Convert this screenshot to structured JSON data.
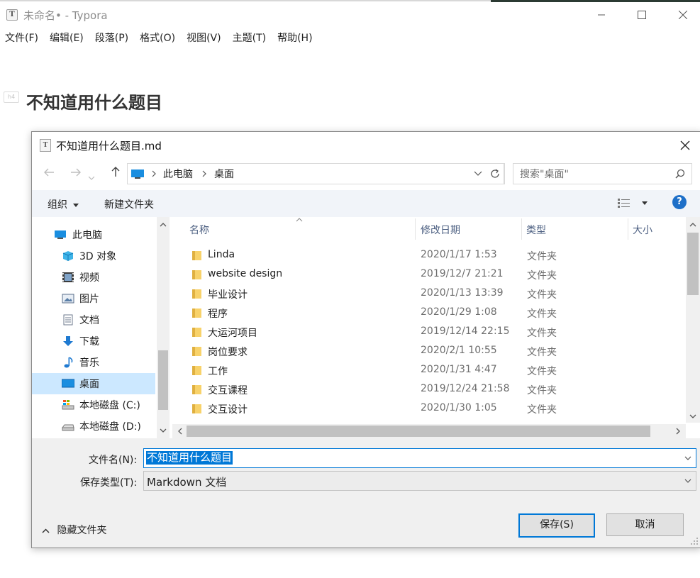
{
  "window": {
    "app_icon_letter": "T",
    "title": "未命名• - Typora"
  },
  "menu": [
    "文件(F)",
    "编辑(E)",
    "段落(P)",
    "格式(O)",
    "视图(V)",
    "主题(T)",
    "帮助(H)"
  ],
  "document": {
    "heading_badge": "h4",
    "heading": "不知道用什么题目"
  },
  "dialog": {
    "title": "不知道用什么题目.md",
    "breadcrumb": [
      "此电脑",
      "桌面"
    ],
    "search_placeholder": "搜索\"桌面\"",
    "toolbar": {
      "organize": "组织",
      "new_folder": "新建文件夹"
    },
    "help": "?",
    "sidebar": [
      {
        "label": "此电脑",
        "icon": "computer-icon"
      },
      {
        "label": "3D 对象",
        "icon": "3d-objects-icon"
      },
      {
        "label": "视频",
        "icon": "video-icon"
      },
      {
        "label": "图片",
        "icon": "pictures-icon"
      },
      {
        "label": "文档",
        "icon": "documents-icon"
      },
      {
        "label": "下载",
        "icon": "downloads-icon"
      },
      {
        "label": "音乐",
        "icon": "music-icon"
      },
      {
        "label": "桌面",
        "icon": "desktop-icon",
        "selected": true
      },
      {
        "label": "本地磁盘 (C:)",
        "icon": "drive-c-icon"
      },
      {
        "label": "本地磁盘 (D:)",
        "icon": "drive-icon"
      }
    ],
    "columns": {
      "name": "名称",
      "date": "修改日期",
      "type": "类型",
      "size": "大小"
    },
    "files": [
      {
        "name": "Linda",
        "date": "2020/1/17 1:53",
        "type": "文件夹"
      },
      {
        "name": "website design",
        "date": "2019/12/7 21:21",
        "type": "文件夹"
      },
      {
        "name": "毕业设计",
        "date": "2020/1/13 13:39",
        "type": "文件夹"
      },
      {
        "name": "程序",
        "date": "2020/1/29 1:08",
        "type": "文件夹"
      },
      {
        "name": "大运河项目",
        "date": "2019/12/14 22:15",
        "type": "文件夹"
      },
      {
        "name": "岗位要求",
        "date": "2020/2/1 10:55",
        "type": "文件夹"
      },
      {
        "name": "工作",
        "date": "2020/1/31 4:47",
        "type": "文件夹"
      },
      {
        "name": "交互课程",
        "date": "2019/12/24 21:58",
        "type": "文件夹"
      },
      {
        "name": "交互设计",
        "date": "2020/1/30 1:05",
        "type": "文件夹"
      }
    ],
    "filename_label": "文件名(N):",
    "filename_value": "不知道用什么题目",
    "filetype_label": "保存类型(T):",
    "filetype_value": "Markdown 文档",
    "hide_folders": "隐藏文件夹",
    "save_button": "保存(S)",
    "cancel_button": "取消"
  },
  "colors": {
    "accent": "#0078d7",
    "selection": "#cce8ff",
    "folder": "#f8d26a",
    "header_text": "#4d6082"
  }
}
